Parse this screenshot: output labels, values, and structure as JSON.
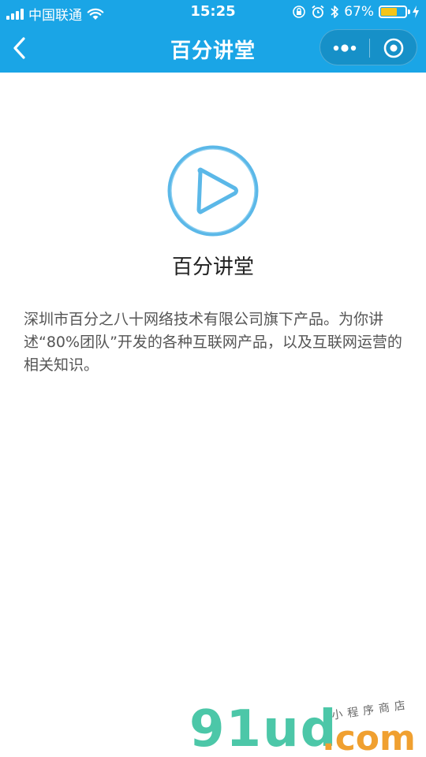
{
  "status_bar": {
    "carrier": "中国联通",
    "time": "15:25",
    "battery_percent_text": "67%",
    "battery_level": 0.67,
    "icons": [
      "signal-icon",
      "wifi-icon",
      "orientation-lock-icon",
      "alarm-icon",
      "bluetooth-icon",
      "battery-icon",
      "charging-icon"
    ]
  },
  "nav": {
    "title": "百分讲堂",
    "back_icon": "chevron-left-icon",
    "more_icon": "more-dots-icon",
    "close_icon": "target-circle-icon"
  },
  "app": {
    "name": "百分讲堂",
    "logo_icon": "play-circle-icon",
    "description": "深圳市百分之八十网络技术有限公司旗下产品。为你讲述“80%团队”开发的各种互联网产品，以及互联网运营的相关知识。"
  },
  "watermark": {
    "main": "91ud",
    "suffix": ".com",
    "tagline": "小程序商店"
  },
  "colors": {
    "nav_bg": "#1aa5e6",
    "accent": "#5bb8e8",
    "battery": "#f5c518"
  }
}
